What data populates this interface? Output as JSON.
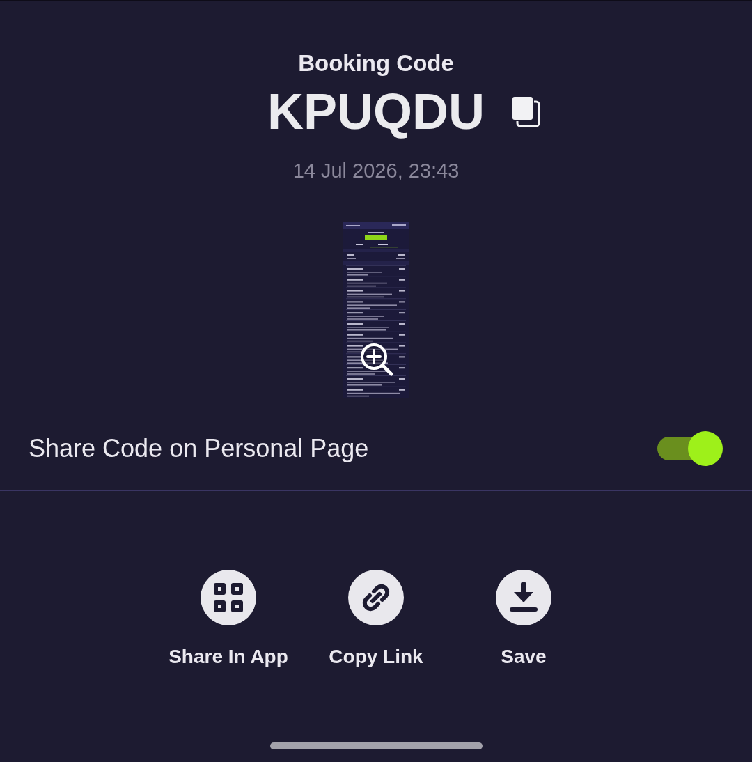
{
  "header": {
    "title": "Booking Code",
    "code": "KPUQDU",
    "date": "14 Jul 2026, 23:43"
  },
  "share_toggle": {
    "label": "Share Code on Personal Page",
    "on": true
  },
  "actions": [
    {
      "kind": "grid",
      "label": "Share In App"
    },
    {
      "kind": "link",
      "label": "Copy Link"
    },
    {
      "kind": "download",
      "label": "Save"
    }
  ]
}
